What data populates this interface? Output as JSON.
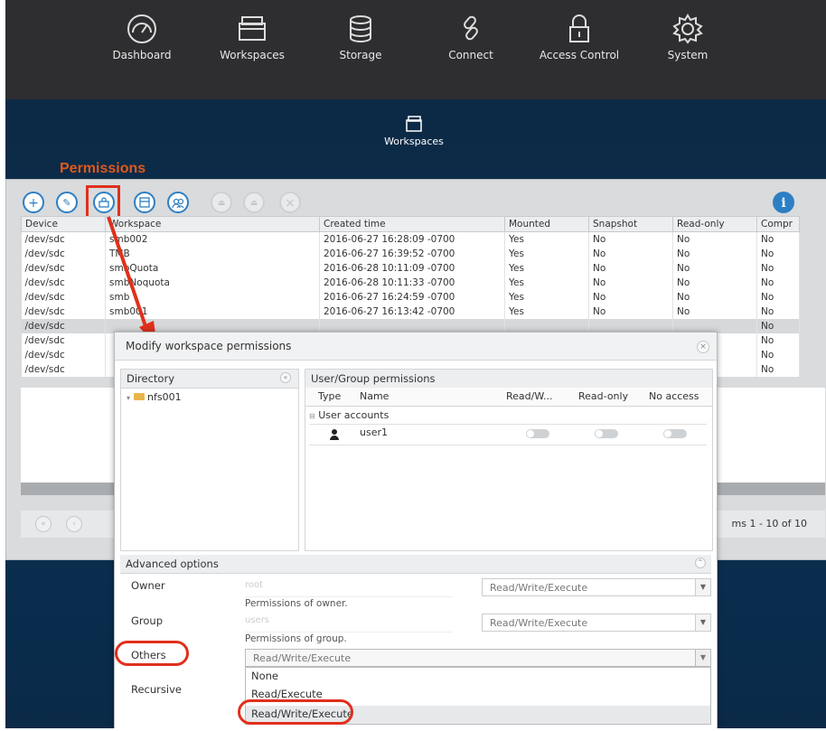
{
  "nav": {
    "items": [
      {
        "label": "Dashboard",
        "icon": "dashboard-icon"
      },
      {
        "label": "Workspaces",
        "icon": "workspaces-icon"
      },
      {
        "label": "Storage",
        "icon": "storage-icon"
      },
      {
        "label": "Connect",
        "icon": "link-icon"
      },
      {
        "label": "Access Control",
        "icon": "lock-icon"
      },
      {
        "label": "System",
        "icon": "gear-icon"
      }
    ]
  },
  "hero": {
    "workspaces_label": "Workspaces"
  },
  "annotation": {
    "permissions_label": "Permissions",
    "color": "#e0301c"
  },
  "toolbar": {
    "add": "+",
    "edit": "✎",
    "permissions": "⬚",
    "snapshot": "▣",
    "users": "👥",
    "info": "i",
    "delete": "×"
  },
  "grid": {
    "columns": [
      "Device",
      "Workspace",
      "Created time",
      "Mounted",
      "Snapshot",
      "Read-only",
      "Compr"
    ],
    "rows": [
      [
        "/dev/sdc",
        "smb002",
        "2016-06-27 16:28:09 -0700",
        "Yes",
        "No",
        "No",
        "No"
      ],
      [
        "/dev/sdc",
        "TMB",
        "2016-06-27 16:39:52 -0700",
        "Yes",
        "No",
        "No",
        "No"
      ],
      [
        "/dev/sdc",
        "smbQuota",
        "2016-06-28 10:11:09 -0700",
        "Yes",
        "No",
        "No",
        "No"
      ],
      [
        "/dev/sdc",
        "smbNoquota",
        "2016-06-28 10:11:33 -0700",
        "Yes",
        "No",
        "No",
        "No"
      ],
      [
        "/dev/sdc",
        "smb",
        "2016-06-27 16:24:59 -0700",
        "Yes",
        "No",
        "No",
        "No"
      ],
      [
        "/dev/sdc",
        "smb001",
        "2016-06-27 16:13:42 -0700",
        "Yes",
        "No",
        "No",
        "No"
      ],
      [
        "/dev/sdc",
        "",
        "",
        "",
        "",
        "",
        "No"
      ],
      [
        "/dev/sdc",
        "",
        "",
        "",
        "",
        "",
        "No"
      ],
      [
        "/dev/sdc",
        "",
        "",
        "",
        "",
        "",
        "No"
      ],
      [
        "/dev/sdc",
        "",
        "",
        "",
        "",
        "",
        "No"
      ]
    ],
    "pager_info": "ms 1 - 10 of 10"
  },
  "dialog": {
    "title": "Modify workspace permissions",
    "directory_header": "Directory",
    "directory_item": "nfs001",
    "ug_header": "User/Group permissions",
    "ug_columns": {
      "type": "Type",
      "name": "Name",
      "rw": "Read/W...",
      "ro": "Read-only",
      "none": "No access"
    },
    "user_group_label": "User accounts",
    "user_name": "user1",
    "advanced": {
      "header": "Advanced options",
      "owner_label": "Owner",
      "owner_value": "root",
      "owner_hint": "Permissions of owner.",
      "owner_select": "Read/Write/Execute",
      "group_label": "Group",
      "group_value": "users",
      "group_hint": "Permissions of group.",
      "group_select": "Read/Write/Execute",
      "others_label": "Others",
      "others_select": "Read/Write/Execute",
      "recursive_label": "Recursive",
      "options": [
        "None",
        "Read/Execute",
        "Read/Write/Execute"
      ]
    }
  }
}
